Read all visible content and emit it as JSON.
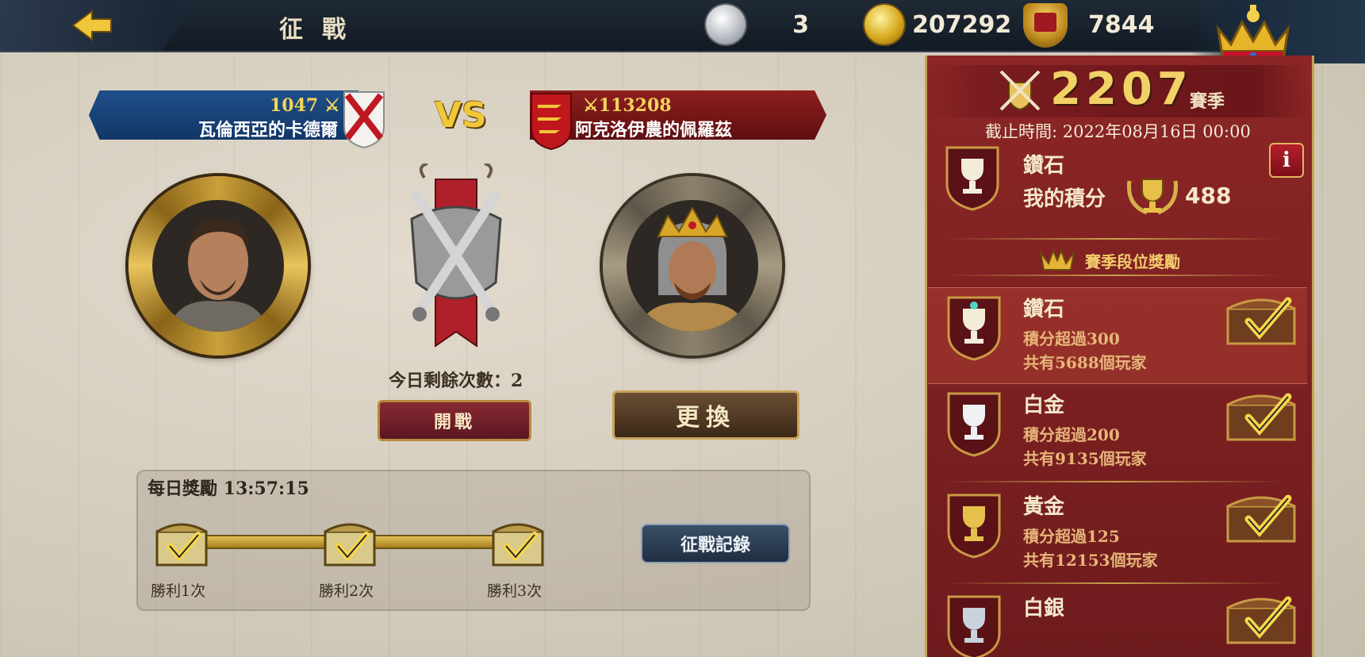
{
  "header": {
    "title": "征戰",
    "silver": "3",
    "gold": "207292",
    "honor": "7844"
  },
  "match": {
    "vs": "VS",
    "player": {
      "power": "1047",
      "name": "瓦倫西亞的卡德爾"
    },
    "enemy": {
      "power": "113208",
      "name": "阿克洛伊農的佩羅茲"
    },
    "remaining": "今日剩餘次數：2",
    "battle_button": "開戰",
    "change_button": "更換"
  },
  "daily": {
    "label": "每日獎勵 13:57:15",
    "milestones": [
      "勝利1次",
      "勝利2次",
      "勝利3次"
    ],
    "record_button": "征戰記錄"
  },
  "season": {
    "score": "2207",
    "season_label": "賽季",
    "deadline": "截止時間: 2022年08月16日 00:00",
    "rank": "鑽石",
    "my_score_label": "我的積分",
    "my_score": "488",
    "info_label": "i",
    "rewards_title": "賽季段位獎勵",
    "tiers": [
      {
        "name": "鑽石",
        "req": "積分超過300",
        "count": "共有5688個玩家"
      },
      {
        "name": "白金",
        "req": "積分超過200",
        "count": "共有9135個玩家"
      },
      {
        "name": "黃金",
        "req": "積分超過125",
        "count": "共有12153個玩家"
      },
      {
        "name": "白銀",
        "req": "",
        "count": ""
      }
    ]
  },
  "icons": {
    "back": "back-arrow-icon",
    "silver": "silver-coin-icon",
    "gold": "gold-coin-icon",
    "honor": "honor-crest-icon",
    "crown": "crown-icon"
  },
  "colors": {
    "player_blue": "#1f4f8a",
    "enemy_red": "#8e1e1e",
    "panel_red": "#8c2626",
    "gold_accent": "#f2d166"
  }
}
